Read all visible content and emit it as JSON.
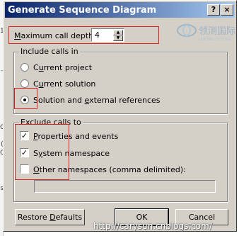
{
  "window": {
    "title": "Generate Sequence Diagram",
    "help_label": "?",
    "close_label": "×"
  },
  "background_fragments": [
    "1e",
    "-",
    "C",
    "(",
    "C",
    "s"
  ],
  "max_depth": {
    "label_prefix": "M",
    "label_rest": "aximum call depth",
    "value": "4"
  },
  "include_group": {
    "legend": "Include calls in",
    "options": [
      {
        "prefix": "C",
        "u": "u",
        "rest": "rrent project",
        "selected": false
      },
      {
        "prefix": "C",
        "u": "u",
        "rest": "rrent solution",
        "selected": false
      },
      {
        "prefix": "Solution and ",
        "u": "e",
        "rest": "xternal references",
        "selected": true
      }
    ]
  },
  "exclude_group": {
    "legend": "Exclude calls to",
    "options": [
      {
        "prefix": "",
        "u": "P",
        "rest": "roperties and events",
        "checked": true
      },
      {
        "prefix": "S",
        "u": "y",
        "rest": "stem namespace",
        "checked": true
      },
      {
        "prefix": "",
        "u": "O",
        "rest": "ther namespaces (comma delimited):",
        "checked": false
      }
    ],
    "other_namespaces_value": ""
  },
  "buttons": {
    "restore": {
      "prefix": "Restore ",
      "u": "D",
      "rest": "efaults"
    },
    "ok": "OK",
    "cancel": "Cancel"
  },
  "watermark": {
    "logo_text": "领测国际",
    "logo_sub": "LEADING TESTING",
    "url": "http://carysun.cnblogs.com/"
  },
  "colors": {
    "titlebar_start": "#0a246a",
    "titlebar_end": "#a6caf0",
    "annotation_red": "#e02020"
  }
}
